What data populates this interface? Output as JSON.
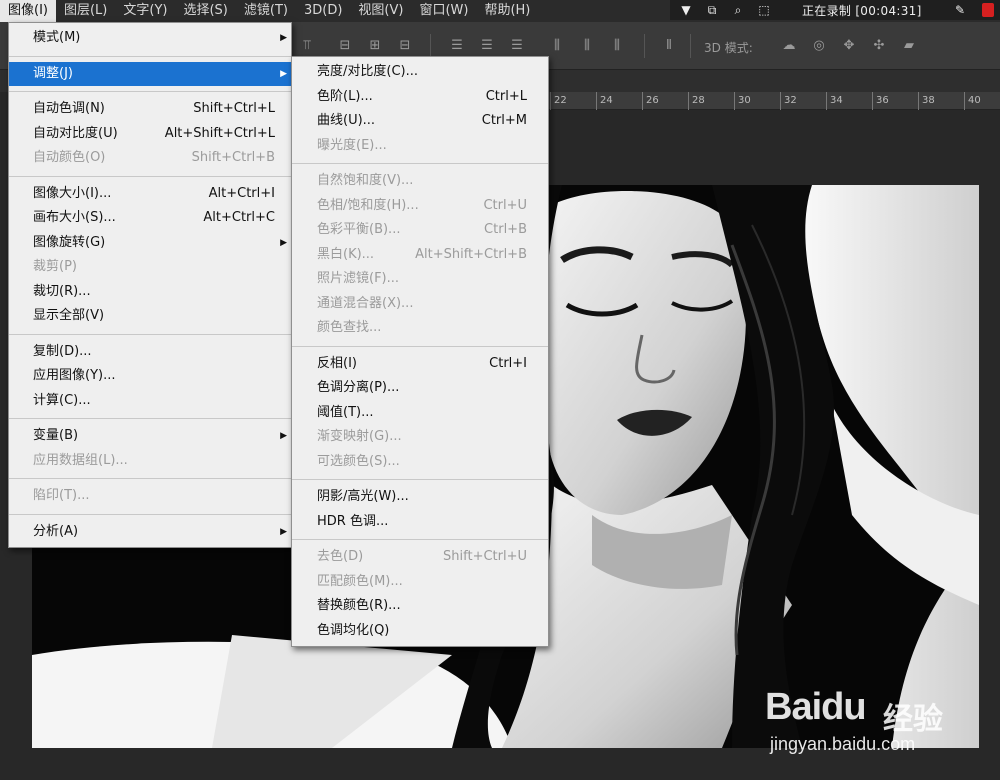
{
  "menubar": {
    "items": [
      {
        "label": "图像(I)",
        "active": true
      },
      {
        "label": "图层(L)"
      },
      {
        "label": "文字(Y)"
      },
      {
        "label": "选择(S)"
      },
      {
        "label": "滤镜(T)"
      },
      {
        "label": "3D(D)"
      },
      {
        "label": "视图(V)"
      },
      {
        "label": "窗口(W)"
      },
      {
        "label": "帮助(H)"
      }
    ]
  },
  "recorder": {
    "status": "正在录制 [00:04:31]",
    "icons": [
      "triangle-down-icon",
      "windows-icon",
      "magnifier-icon",
      "region-icon",
      "pencil-icon",
      "stop-icon"
    ]
  },
  "optionsbar": {
    "mode3d_label": "3D 模式:"
  },
  "ruler": {
    "ticks": [
      "22",
      "24",
      "26",
      "28",
      "30",
      "32",
      "34",
      "36",
      "38",
      "40"
    ]
  },
  "image_menu": {
    "items": [
      {
        "label": "模式(M)",
        "submenu": true
      },
      {
        "sep": true
      },
      {
        "label": "调整(J)",
        "submenu": true,
        "highlighted": true
      },
      {
        "sep": true
      },
      {
        "label": "自动色调(N)",
        "shortcut": "Shift+Ctrl+L"
      },
      {
        "label": "自动对比度(U)",
        "shortcut": "Alt+Shift+Ctrl+L"
      },
      {
        "label": "自动颜色(O)",
        "shortcut": "Shift+Ctrl+B",
        "disabled": true
      },
      {
        "sep": true
      },
      {
        "label": "图像大小(I)...",
        "shortcut": "Alt+Ctrl+I"
      },
      {
        "label": "画布大小(S)...",
        "shortcut": "Alt+Ctrl+C"
      },
      {
        "label": "图像旋转(G)",
        "submenu": true
      },
      {
        "label": "裁剪(P)",
        "disabled": true
      },
      {
        "label": "裁切(R)..."
      },
      {
        "label": "显示全部(V)"
      },
      {
        "sep": true
      },
      {
        "label": "复制(D)..."
      },
      {
        "label": "应用图像(Y)..."
      },
      {
        "label": "计算(C)..."
      },
      {
        "sep": true
      },
      {
        "label": "变量(B)",
        "submenu": true
      },
      {
        "label": "应用数据组(L)...",
        "disabled": true
      },
      {
        "sep": true
      },
      {
        "label": "陷印(T)...",
        "disabled": true
      },
      {
        "sep": true
      },
      {
        "label": "分析(A)",
        "submenu": true
      }
    ]
  },
  "adjust_menu": {
    "items": [
      {
        "label": "亮度/对比度(C)..."
      },
      {
        "label": "色阶(L)...",
        "shortcut": "Ctrl+L"
      },
      {
        "label": "曲线(U)...",
        "shortcut": "Ctrl+M"
      },
      {
        "label": "曝光度(E)...",
        "disabled": true
      },
      {
        "sep": true
      },
      {
        "label": "自然饱和度(V)...",
        "disabled": true
      },
      {
        "label": "色相/饱和度(H)...",
        "shortcut": "Ctrl+U",
        "disabled": true
      },
      {
        "label": "色彩平衡(B)...",
        "shortcut": "Ctrl+B",
        "disabled": true
      },
      {
        "label": "黑白(K)...",
        "shortcut": "Alt+Shift+Ctrl+B",
        "disabled": true
      },
      {
        "label": "照片滤镜(F)...",
        "disabled": true
      },
      {
        "label": "通道混合器(X)...",
        "disabled": true
      },
      {
        "label": "颜色查找...",
        "disabled": true
      },
      {
        "sep": true
      },
      {
        "label": "反相(I)",
        "shortcut": "Ctrl+I"
      },
      {
        "label": "色调分离(P)..."
      },
      {
        "label": "阈值(T)..."
      },
      {
        "label": "渐变映射(G)...",
        "disabled": true
      },
      {
        "label": "可选颜色(S)...",
        "disabled": true
      },
      {
        "sep": true
      },
      {
        "label": "阴影/高光(W)..."
      },
      {
        "label": "HDR 色调..."
      },
      {
        "sep": true
      },
      {
        "label": "去色(D)",
        "shortcut": "Shift+Ctrl+U",
        "disabled": true
      },
      {
        "label": "匹配颜色(M)...",
        "disabled": true
      },
      {
        "label": "替换颜色(R)..."
      },
      {
        "label": "色调均化(Q)"
      }
    ]
  },
  "watermark": {
    "logo": "Baidu",
    "jingyan": "经验",
    "url": "jingyan.baidu.com"
  }
}
